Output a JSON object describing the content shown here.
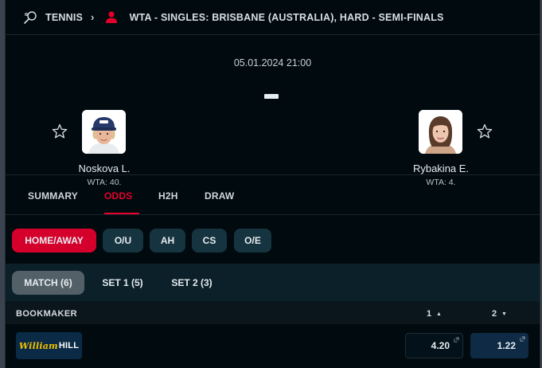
{
  "breadcrumb": {
    "sport": "TENNIS",
    "competition": "WTA - SINGLES: BRISBANE (AUSTRALIA), HARD - SEMI-FINALS"
  },
  "match": {
    "datetime": "05.01.2024 21:00",
    "home": {
      "name": "Noskova L.",
      "rank": "WTA: 40."
    },
    "away": {
      "name": "Rybakina E.",
      "rank": "WTA: 4."
    }
  },
  "tabs": [
    {
      "label": "SUMMARY"
    },
    {
      "label": "ODDS",
      "active": true
    },
    {
      "label": "H2H"
    },
    {
      "label": "DRAW"
    }
  ],
  "market_tabs": [
    {
      "label": "HOME/AWAY",
      "active": true
    },
    {
      "label": "O/U"
    },
    {
      "label": "AH"
    },
    {
      "label": "CS"
    },
    {
      "label": "O/E"
    }
  ],
  "period_tabs": [
    {
      "label": "MATCH (6)",
      "active": true
    },
    {
      "label": "SET 1 (5)"
    },
    {
      "label": "SET 2 (3)"
    }
  ],
  "odds_table": {
    "col_bookmaker": "BOOKMAKER",
    "col_1": "1",
    "col_2": "2",
    "rows": [
      {
        "bookmaker_script": "William",
        "bookmaker_bold": "HILL",
        "odd_1": "4.20",
        "odd_2": "1.22"
      }
    ]
  },
  "colors": {
    "accent": "#e4002b",
    "background": "#010a0f",
    "pill": "#16343f",
    "odd_favourite": "#0f2a45"
  }
}
